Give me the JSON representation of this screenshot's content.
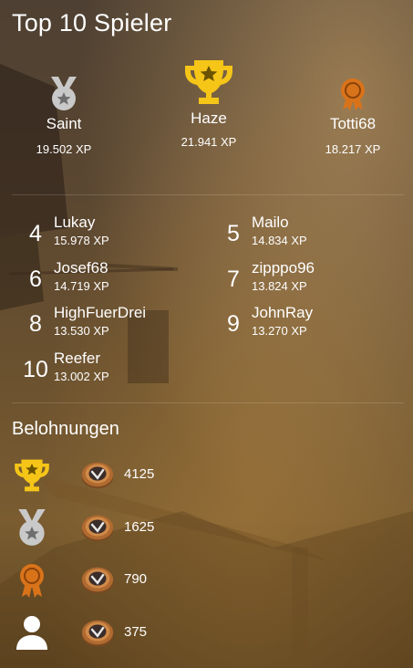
{
  "title": "Top 10 Spieler",
  "podium": {
    "first": {
      "name": "Haze",
      "xp": "21.941 XP",
      "icon": "trophy-icon"
    },
    "second": {
      "name": "Saint",
      "xp": "19.502 XP",
      "icon": "silver-medal-icon"
    },
    "third": {
      "name": "Totti68",
      "xp": "18.217 XP",
      "icon": "bronze-rosette-icon"
    }
  },
  "ranks": [
    {
      "rank": "4",
      "name": "Lukay",
      "xp": "15.978 XP"
    },
    {
      "rank": "5",
      "name": "Mailo",
      "xp": "14.834 XP"
    },
    {
      "rank": "6",
      "name": "Josef68",
      "xp": "14.719 XP"
    },
    {
      "rank": "7",
      "name": "zipppo96",
      "xp": "13.824 XP"
    },
    {
      "rank": "8",
      "name": "HighFuerDrei",
      "xp": "13.530 XP"
    },
    {
      "rank": "9",
      "name": "JohnRay",
      "xp": "13.270 XP"
    },
    {
      "rank": "10",
      "name": "Reefer",
      "xp": "13.002 XP"
    }
  ],
  "rewards": {
    "title": "Belohnungen",
    "items": [
      {
        "icon": "trophy-icon",
        "coin_icon": "coin-icon",
        "amount": "4125"
      },
      {
        "icon": "silver-medal-icon",
        "coin_icon": "coin-icon",
        "amount": "1625"
      },
      {
        "icon": "bronze-rosette-icon",
        "coin_icon": "coin-icon",
        "amount": "790"
      },
      {
        "icon": "person-icon",
        "coin_icon": "coin-icon",
        "amount": "375"
      }
    ]
  },
  "colors": {
    "gold": "#f5c518",
    "silver": "#c9c9c9",
    "bronze": "#d9731a",
    "text": "#ffffff"
  }
}
